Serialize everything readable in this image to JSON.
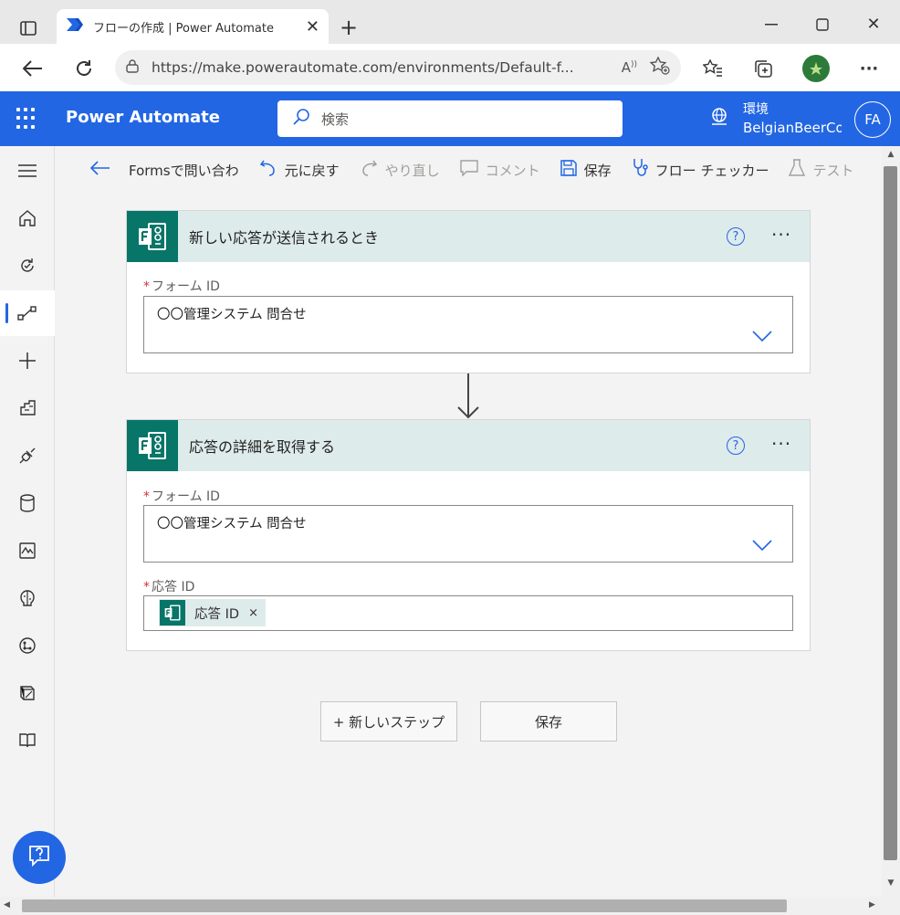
{
  "browser": {
    "tab_title": "フローの作成 | Power Automate",
    "url": "https://make.powerautomate.com/environments/Default-f..."
  },
  "header": {
    "app_name": "Power Automate",
    "search_placeholder": "検索",
    "env_label": "環境",
    "env_name": "BelgianBeerCo",
    "avatar_initials": "FA"
  },
  "commands": {
    "back_title": "Formsで問い合わ",
    "undo": "元に戻す",
    "redo": "やり直し",
    "comment": "コメント",
    "save": "保存",
    "flow_checker": "フロー チェッカー",
    "test": "テスト"
  },
  "cards": [
    {
      "title": "新しい応答が送信されるとき",
      "fields": [
        {
          "label": "フォーム ID",
          "required_mark": "*",
          "value": "〇〇管理システム 問合せ"
        }
      ]
    },
    {
      "title": "応答の詳細を取得する",
      "fields": [
        {
          "label": "フォーム ID",
          "required_mark": "*",
          "value": "〇〇管理システム 問合せ"
        },
        {
          "label": "応答 ID",
          "required_mark": "*",
          "token": "応答 ID",
          "token_remove": "×"
        }
      ]
    }
  ],
  "actions": {
    "new_step": "+ 新しいステップ",
    "save": "保存"
  },
  "help_glyph": "?",
  "more_glyph": "···",
  "colors": {
    "brand_blue": "#2266e3",
    "forms_teal": "#077568",
    "card_header": "#deebeb",
    "required": "#d13438"
  }
}
